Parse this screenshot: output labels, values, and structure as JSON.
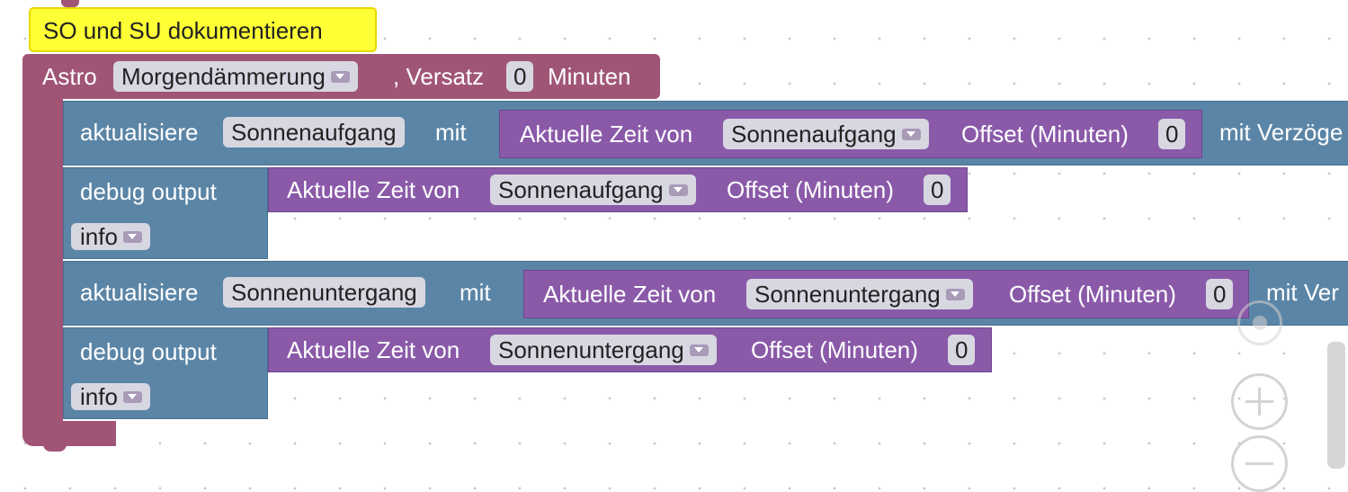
{
  "comment": {
    "text": "SO und SU dokumentieren"
  },
  "astro_block": {
    "label": "Astro",
    "event": "Morgendämmerung",
    "offset_label": ", Versatz",
    "offset_value": "0",
    "unit_label": "Minuten"
  },
  "statements": [
    {
      "keyword": "aktualisiere",
      "variable": "Sonnenaufgang",
      "with_label": "mit",
      "expr_label": "Aktuelle Zeit von",
      "expr_value": "Sonnenaufgang",
      "offset_label": "Offset (Minuten)",
      "offset_value": "0",
      "delay_label": "mit Verzöge"
    },
    {
      "keyword": "debug output",
      "expr_label": "Aktuelle Zeit von",
      "expr_value": "Sonnenaufgang",
      "offset_label": "Offset (Minuten)",
      "offset_value": "0",
      "level": "info"
    },
    {
      "keyword": "aktualisiere",
      "variable": "Sonnenuntergang",
      "with_label": "mit",
      "expr_label": "Aktuelle Zeit von",
      "expr_value": "Sonnenuntergang",
      "offset_label": "Offset (Minuten)",
      "offset_value": "0",
      "delay_label": "mit Ver"
    },
    {
      "keyword": "debug output",
      "expr_label": "Aktuelle Zeit von",
      "expr_value": "Sonnenuntergang",
      "offset_label": "Offset (Minuten)",
      "offset_value": "0",
      "level": "info"
    }
  ],
  "colors": {
    "event_block": "#a05577",
    "action_block": "#5b85a6",
    "value_block": "#8a5aa9",
    "comment": "#ffff35"
  },
  "controls": {
    "recenter_icon": "target-icon",
    "zoom_in_icon": "plus-icon",
    "zoom_out_icon": "minus-icon"
  }
}
